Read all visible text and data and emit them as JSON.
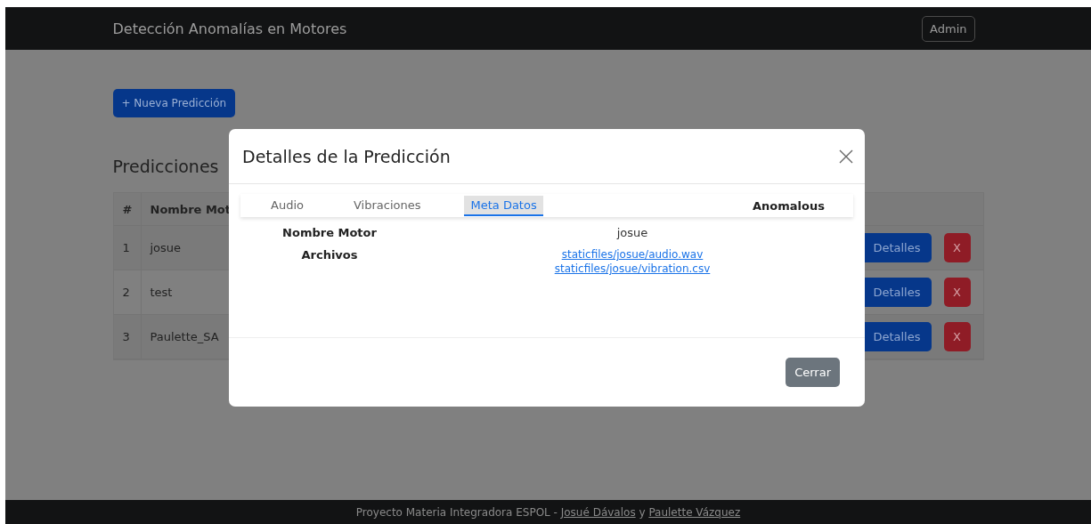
{
  "navbar": {
    "brand": "Detección Anomalías en Motores",
    "admin_button": "Admin"
  },
  "new_button": "+ Nueva Predicción",
  "heading": "Predicciones",
  "table": {
    "columns": [
      "#",
      "Nombre Mot"
    ],
    "rows": [
      {
        "num": "1",
        "name": "josue",
        "details_button": "Detalles",
        "delete_button": "X"
      },
      {
        "num": "2",
        "name": "test",
        "details_button": "Detalles",
        "delete_button": "X"
      },
      {
        "num": "3",
        "name": "Paulette_SA",
        "details_button": "Detalles",
        "delete_button": "X"
      }
    ]
  },
  "modal": {
    "title": "Detalles de la Predicción",
    "tabs": [
      {
        "label": "Audio",
        "selected": false
      },
      {
        "label": "Vibraciones",
        "selected": false
      },
      {
        "label": "Meta Datos",
        "selected": true
      }
    ],
    "status": "Anomalous",
    "fields": [
      {
        "label": "Nombre Motor",
        "values": [
          {
            "kind": "text",
            "text": "josue"
          }
        ]
      },
      {
        "label": "Archivos",
        "values": [
          {
            "kind": "link",
            "text": "staticfiles/josue/audio.wav"
          },
          {
            "kind": "link",
            "text": "staticfiles/josue/vibration.csv"
          }
        ]
      }
    ],
    "close_button": "Cerrar"
  },
  "footer": [
    {
      "kind": "text",
      "text": "Proyecto Materia Integradora ESPOL - "
    },
    {
      "kind": "link",
      "text": "Josué Dávalos"
    },
    {
      "kind": "text",
      "text": " y "
    },
    {
      "kind": "link",
      "text": "Paulette Vázquez"
    }
  ]
}
